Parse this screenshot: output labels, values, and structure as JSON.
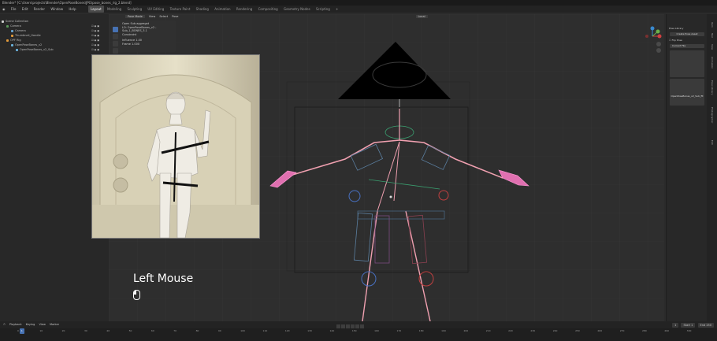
{
  "window": {
    "title": "Blender* [C:\\Users\\projects\\Blender\\OpenPoseBones\\JPG\\pose_bones_rig_2.blend]"
  },
  "menu": [
    "File",
    "Edit",
    "Render",
    "Window",
    "Help"
  ],
  "workspaces": [
    {
      "label": "Layout",
      "active": true
    },
    {
      "label": "Modeling"
    },
    {
      "label": "Sculpting"
    },
    {
      "label": "UV Editing"
    },
    {
      "label": "Texture Paint"
    },
    {
      "label": "Shading"
    },
    {
      "label": "Animation"
    },
    {
      "label": "Rendering"
    },
    {
      "label": "Compositing"
    },
    {
      "label": "Geometry Nodes"
    },
    {
      "label": "Scripting"
    },
    {
      "label": "+"
    }
  ],
  "outliner": {
    "rows": [
      {
        "label": "Scene Collection",
        "color": "#d0d0d0"
      },
      {
        "label": "Camera",
        "color": "#5a9a5a"
      },
      {
        "label": "Camera",
        "color": "#6aa5d0"
      },
      {
        "label": "Thumbnail_Handle",
        "color": "#e29a3b"
      },
      {
        "label": "OPF Rig",
        "color": "#e29a3b"
      },
      {
        "label": "OpenPoseBones_v2",
        "color": "#6ab0d9"
      },
      {
        "label": "OpenPoseBones_v2_Sub",
        "color": "#6ab0d9"
      }
    ]
  },
  "viewport_header": {
    "mode": "Pose Mode",
    "view_menu": [
      "View",
      "Select",
      "Pose"
    ],
    "orientation": "Local"
  },
  "operator_panel": {
    "title": "Open Sub.aggregat",
    "lines": [
      "LO: OpenPoseBones_v2 - Sub_1_BONES_3.1",
      "Constraint",
      "Influence  1.00",
      "Frame  1.000"
    ]
  },
  "keycast": {
    "text": "Left Mouse"
  },
  "properties": {
    "panel_title": "Pose Library",
    "buttons": [
      "Create Pose Asset",
      "Flip Pose"
    ],
    "dropdown": "Current File",
    "thumbnails": [
      "",
      "OpenPoseBones_v2_Sub_fit"
    ]
  },
  "side_tabs": [
    "Item",
    "Tool",
    "View",
    "Animation",
    "Pose Library",
    "Photographer",
    "Edit"
  ],
  "timeline": {
    "menu": [
      "Playback",
      "Keying",
      "View",
      "Marker"
    ],
    "current_frame": "1",
    "start_label": "Start",
    "start": "1",
    "end_label": "End",
    "end": "250",
    "ticks": [
      "0",
      "10",
      "20",
      "30",
      "40",
      "50",
      "60",
      "70",
      "80",
      "90",
      "100",
      "110",
      "120",
      "130",
      "140",
      "150",
      "160",
      "170",
      "180",
      "190",
      "200",
      "210",
      "220",
      "230",
      "240",
      "250",
      "260",
      "270",
      "280",
      "290",
      "300"
    ]
  },
  "colors": {
    "accent": "#4772b3",
    "bone": "#f0a0b0",
    "hand": "#e070b0",
    "edge": "#ffffff"
  }
}
